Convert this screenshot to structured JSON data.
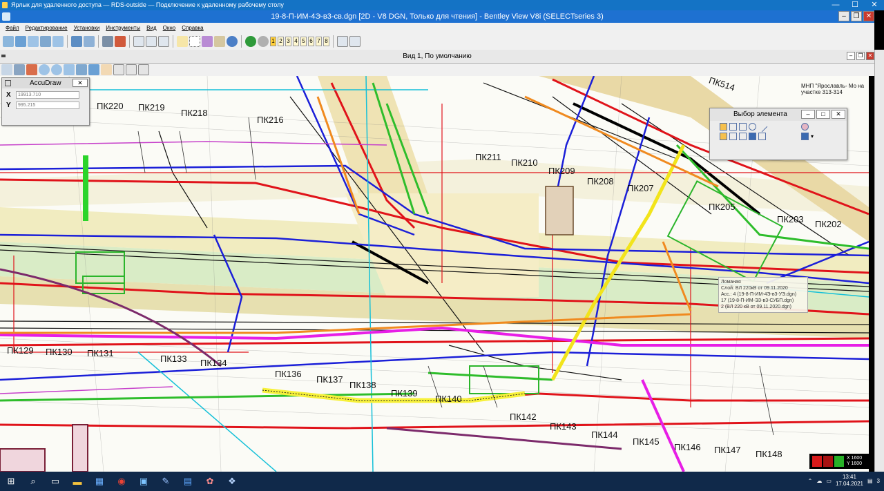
{
  "rds": {
    "title": "Ярлык для удаленного доступа — RDS-outside — Подключение к удаленному рабочему столу",
    "min": "—",
    "max": "☐",
    "close": "✕"
  },
  "app": {
    "title": "19-8-П-ИМ-4Э-в3-св.dgn [2D - V8 DGN, Только для чтения] - Bentley View V8i (SELECTseries 3)",
    "min": "‒",
    "restore": "❐",
    "close": "✕"
  },
  "menu": [
    "Файл",
    "Редактирование",
    "Установки",
    "Инструменты",
    "Вид",
    "Окно",
    "Справка"
  ],
  "view_numbers": [
    "1",
    "2",
    "3",
    "4",
    "5",
    "6",
    "7",
    "8"
  ],
  "viewport": {
    "title": "Вид 1, По умолчанию"
  },
  "accudraw": {
    "title": "AccuDraw",
    "close": "✕",
    "x_label": "X",
    "y_label": "Y",
    "x_value": "19913.710",
    "y_value": "995.215"
  },
  "select_element": {
    "title": "Выбор элемента",
    "min": "‒",
    "max": "□",
    "close": "✕"
  },
  "tooltip": {
    "line1": "Ломаная",
    "line2": "Слой:  ВЛ 220кВ от 09.11.2020",
    "line3": "Асс.: 4 (19-8-П-ИМ-4Э-в3-УЭ.dgn)",
    "line4": "  17 (19-8-П-ИМ-ЭЗ-в3-СУБП.dgn)",
    "line5": "  2 (ВЛ 220 кВ от 09.11.2020.dgn)"
  },
  "pk_labels": [
    "ПК220",
    "ПК219",
    "ПК218",
    "ПК216",
    "ПК211",
    "ПК210",
    "ПК209",
    "ПК208",
    "ПК207",
    "ПК205",
    "ПК203",
    "ПК202",
    "ПК514",
    "ПК129",
    "ПК130",
    "ПК131",
    "ПК133",
    "ПК134",
    "ПК136",
    "ПК137",
    "ПК138",
    "ПК139",
    "ПК140",
    "ПК142",
    "ПК143",
    "ПК144",
    "ПК145",
    "ПК146",
    "ПК147",
    "ПК148"
  ],
  "map_note": "МНП \"Ярославль- Мо на участке 313-314",
  "status": {
    "x": "X 1600",
    "y": "Y 1600"
  },
  "taskbar": {
    "time": "13:41",
    "date": "17.04.2021",
    "notif": "3"
  },
  "colors": {
    "rds_bar": "#1473c5",
    "title_bar": "#1e71d1",
    "taskbar": "#10294a",
    "canvas_bg": "#fbfbf6"
  }
}
